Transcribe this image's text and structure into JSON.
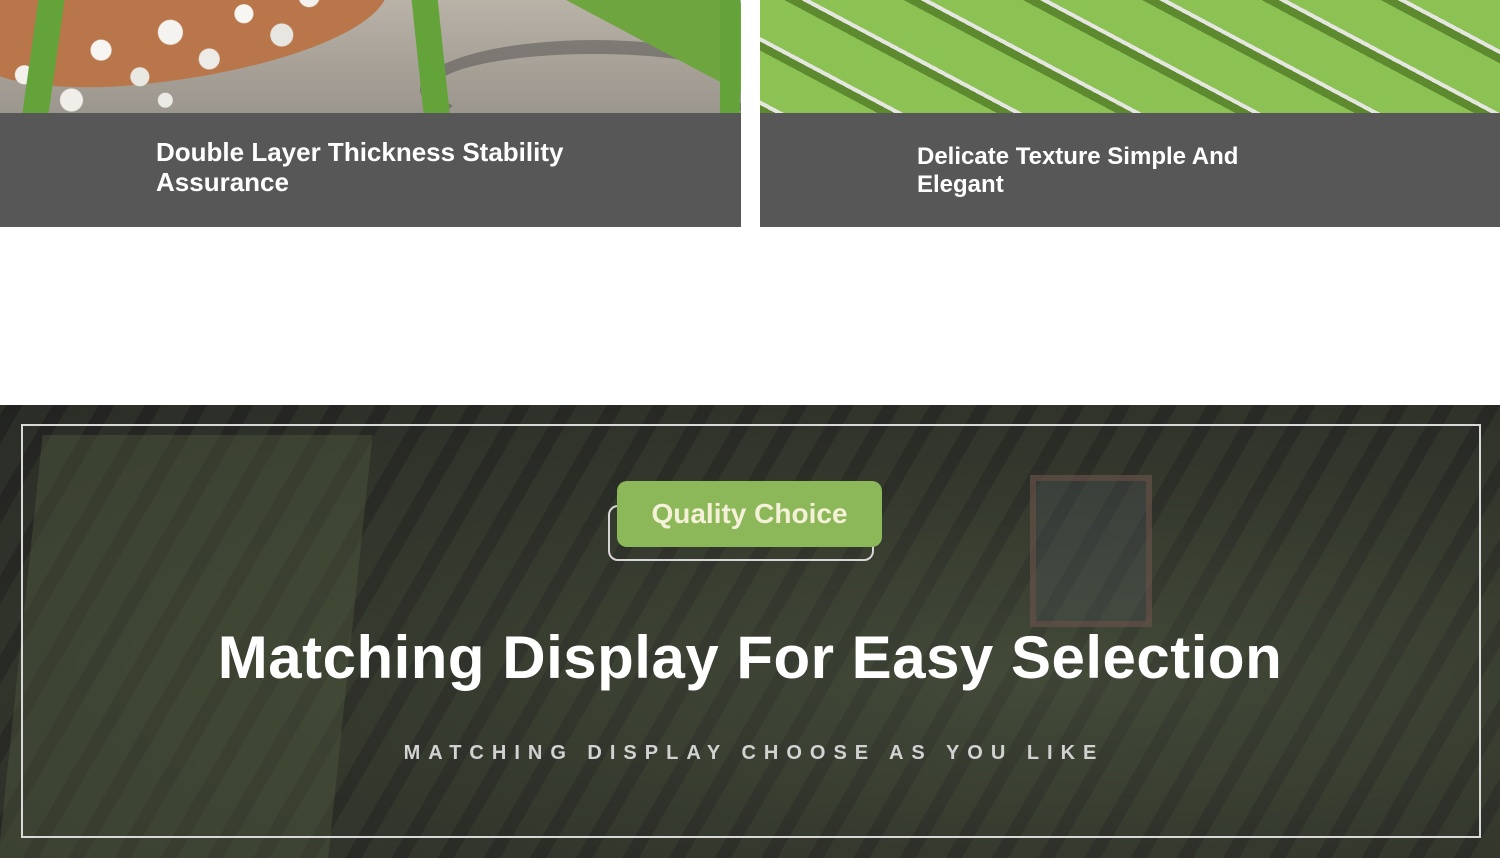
{
  "features": [
    {
      "caption": "Double Layer Thickness Stability Assurance"
    },
    {
      "caption": "Delicate Texture Simple And Elegant"
    }
  ],
  "banner": {
    "badge": "Quality Choice",
    "headline": "Matching Display For Easy Selection",
    "subline": "MATCHING DISPLAY CHOOSE AS YOU LIKE"
  },
  "colors": {
    "caption_bar": "#575757",
    "badge": "#8cb85a",
    "accent_green": "#64a33a"
  }
}
